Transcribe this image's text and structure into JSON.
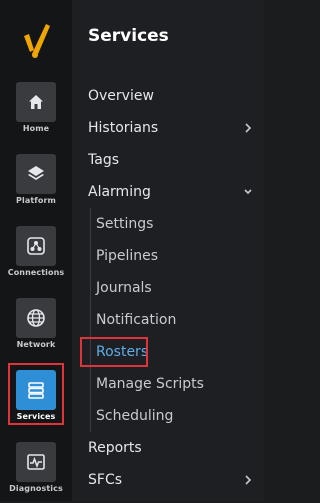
{
  "rail": {
    "items": [
      {
        "id": "home",
        "label": "Home",
        "icon": "home-icon"
      },
      {
        "id": "platform",
        "label": "Platform",
        "icon": "layers-icon"
      },
      {
        "id": "connections",
        "label": "Connections",
        "icon": "connections-icon"
      },
      {
        "id": "network",
        "label": "Network",
        "icon": "globe-icon"
      },
      {
        "id": "services",
        "label": "Services",
        "icon": "services-icon",
        "active": true
      },
      {
        "id": "diagnostics",
        "label": "Diagnostics",
        "icon": "pulse-icon"
      }
    ]
  },
  "panel": {
    "title": "Services",
    "items": [
      {
        "label": "Overview"
      },
      {
        "label": "Historians",
        "chevron": "right"
      },
      {
        "label": "Tags"
      },
      {
        "label": "Alarming",
        "chevron": "down",
        "expanded": true
      },
      {
        "label": "Reports"
      },
      {
        "label": "SFCs",
        "chevron": "right"
      }
    ],
    "alarming_children": [
      {
        "label": "Settings"
      },
      {
        "label": "Pipelines"
      },
      {
        "label": "Journals"
      },
      {
        "label": "Notification"
      },
      {
        "label": "Rosters",
        "selected": true
      },
      {
        "label": "Manage Scripts"
      },
      {
        "label": "Scheduling"
      }
    ]
  },
  "colors": {
    "accent": "#2f8fd6",
    "selected_text": "#5eaee8",
    "highlight": "#e0343a",
    "logo": "#f0a500"
  }
}
